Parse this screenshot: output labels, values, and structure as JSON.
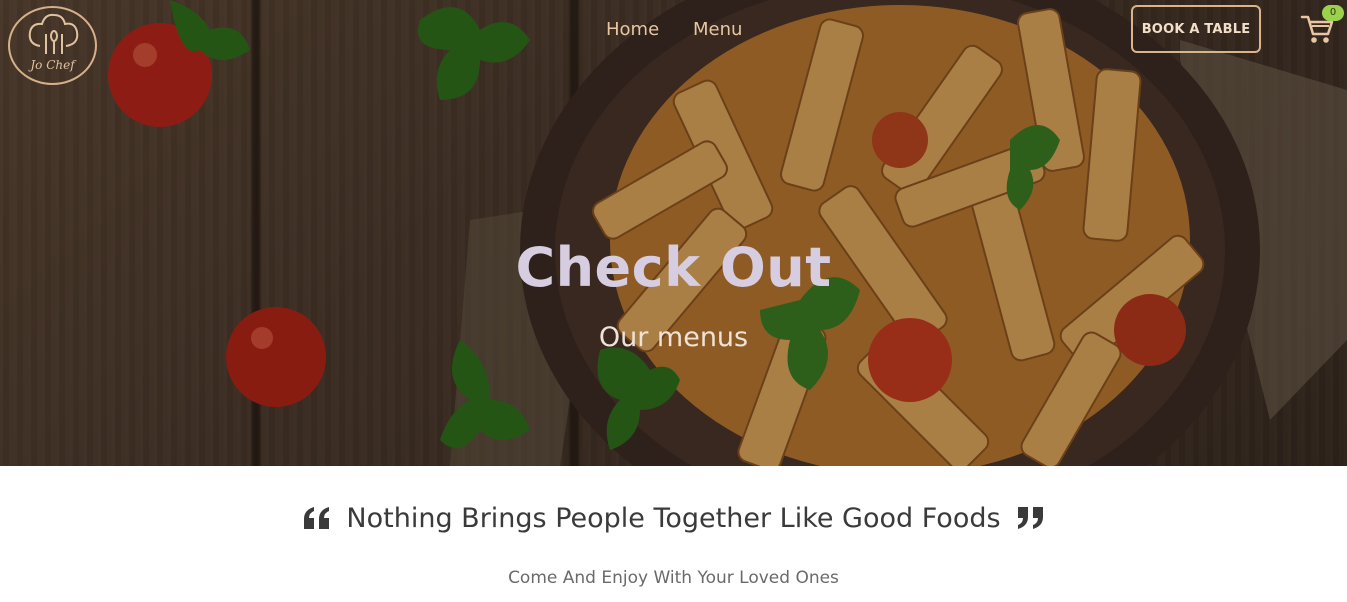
{
  "brand": {
    "logo_text": "Jo Chef"
  },
  "nav": {
    "links": [
      {
        "label": "Home"
      },
      {
        "label": "Menu"
      }
    ],
    "book_label": "BOOK A TABLE",
    "cart_count": "0"
  },
  "hero": {
    "title": "Check Out",
    "subtitle": "Our menus"
  },
  "quote": {
    "text": "Nothing Brings People Together Like Good Foods"
  },
  "tagline": "Come And Enjoy With Your Loved Ones",
  "colors": {
    "accent": "#d9b48d",
    "badge": "#9bd14b",
    "title": "#d6cde1"
  }
}
